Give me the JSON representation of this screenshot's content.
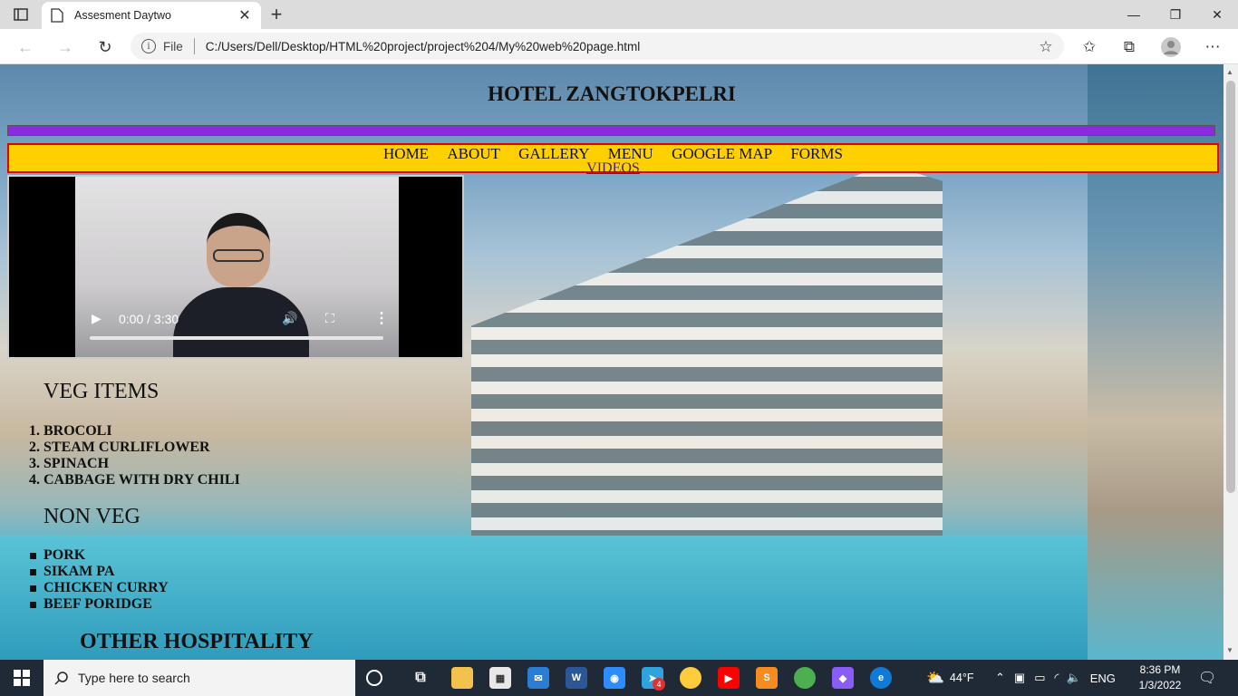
{
  "browser": {
    "tab_title": "Assesment Daytwo",
    "address_prefix": "File",
    "url": "C:/Users/Dell/Desktop/HTML%20project/project%204/My%20web%20page.html"
  },
  "page": {
    "title": "HOTEL ZANGTOKPELRI",
    "nav": {
      "home": "HOME",
      "about": "ABOUT",
      "gallery": "GALLERY",
      "menu": "MENU",
      "google_map": "GOOGLE MAP",
      "forms": "FORMS",
      "videos": "VIDEOS"
    },
    "video": {
      "time": "0:00 / 3:30"
    },
    "veg": {
      "heading": "VEG ITEMS",
      "items": [
        "BROCOLI",
        "STEAM CURLIFLOWER",
        "SPINACH",
        "CABBAGE WITH DRY CHILI"
      ]
    },
    "non_veg": {
      "heading": "NON VEG",
      "items": [
        "PORK",
        "SIKAM PA",
        "CHICKEN CURRY",
        "BEEF PORIDGE"
      ]
    },
    "other": {
      "heading": "OTHER HOSPITALITY"
    }
  },
  "taskbar": {
    "search_placeholder": "Type here to search",
    "weather": "44°F",
    "language": "ENG",
    "time": "8:36 PM",
    "date": "1/3/2022",
    "badge_count": "4"
  }
}
